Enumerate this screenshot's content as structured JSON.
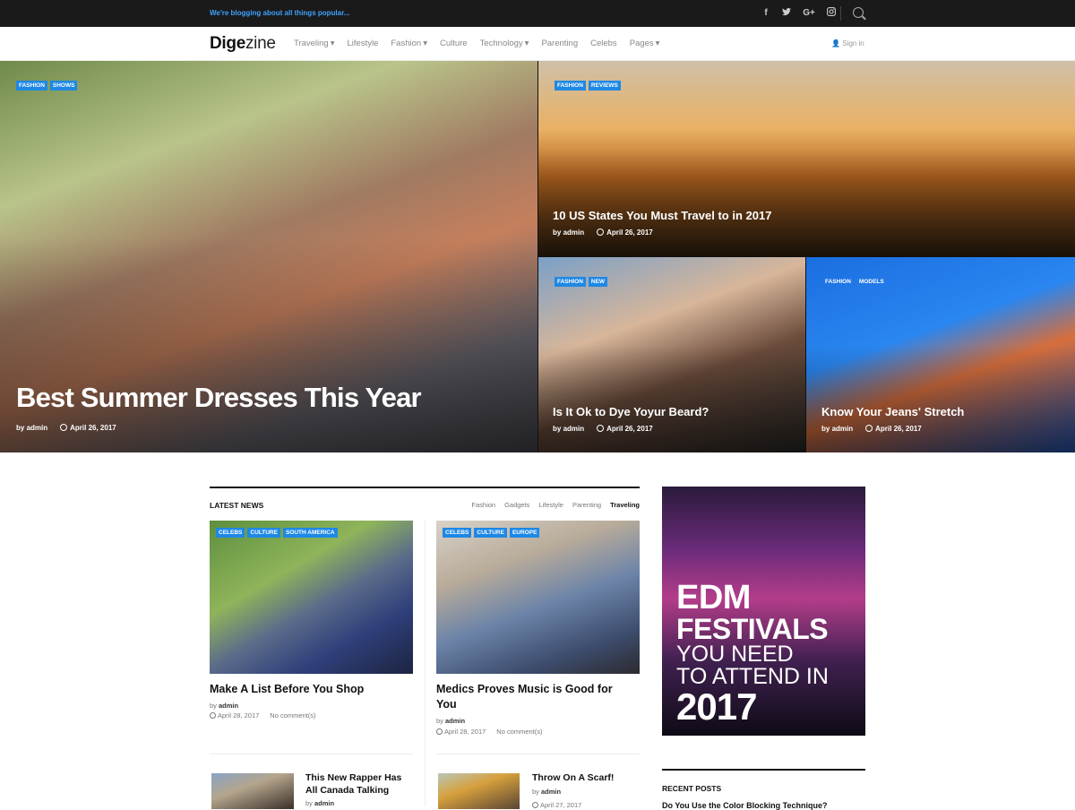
{
  "topbar": {
    "tagline": "We're blogging about all things popular...",
    "social_icons": [
      "facebook-icon",
      "twitter-icon",
      "google-plus-icon",
      "instagram-icon"
    ],
    "social_glyphs": [
      "f",
      "🐦",
      "G+",
      "◎"
    ]
  },
  "nav": {
    "logo_bold": "Dige",
    "logo_light": "zine",
    "items": [
      {
        "label": "Traveling",
        "has_dropdown": true
      },
      {
        "label": "Lifestyle",
        "has_dropdown": false
      },
      {
        "label": "Fashion",
        "has_dropdown": true
      },
      {
        "label": "Culture",
        "has_dropdown": false
      },
      {
        "label": "Technology",
        "has_dropdown": true
      },
      {
        "label": "Parenting",
        "has_dropdown": false
      },
      {
        "label": "Celebs",
        "has_dropdown": false
      },
      {
        "label": "Pages",
        "has_dropdown": true
      }
    ],
    "signin": "Sign in"
  },
  "hero": {
    "main": {
      "tags": [
        "FASHION",
        "SHOWS"
      ],
      "title": "Best Summer Dresses This Year",
      "author_prefix": "by",
      "author": "admin",
      "date": "April 26, 2017"
    },
    "top_right": {
      "tags": [
        "FASHION",
        "REVIEWS"
      ],
      "title": "10 US States You Must Travel to in 2017",
      "author_prefix": "by",
      "author": "admin",
      "date": "April 26, 2017"
    },
    "bottom_mid": {
      "tags": [
        "FASHION",
        "NEW"
      ],
      "title": "Is It Ok to Dye Yoyur Beard?",
      "author_prefix": "by",
      "author": "admin",
      "date": "April 26, 2017"
    },
    "bottom_right": {
      "tags": [
        "FASHION",
        "MODELS"
      ],
      "title": "Know Your Jeans' Stretch",
      "author_prefix": "by",
      "author": "admin",
      "date": "April 26, 2017"
    }
  },
  "latest": {
    "heading": "LATEST NEWS",
    "filters": [
      "Fashion",
      "Gadgets",
      "Lifestyle",
      "Parenting",
      "Traveling"
    ],
    "active_filter": "Traveling",
    "cards": [
      {
        "tags": [
          "CELEBS",
          "CULTURE",
          "SOUTH AMERICA"
        ],
        "title": "Make A List Before You Shop",
        "by": "by",
        "author": "admin",
        "date": "April 28, 2017",
        "comments": "No comment(s)"
      },
      {
        "tags": [
          "CELEBS",
          "CULTURE",
          "EUROPE"
        ],
        "title": "Medics Proves Music is Good for You",
        "by": "by",
        "author": "admin",
        "date": "April 28, 2017",
        "comments": "No comment(s)"
      }
    ],
    "small": [
      {
        "title": "This New Rapper Has All Canada Talking",
        "by": "by",
        "author": "admin"
      },
      {
        "title": "Throw On A Scarf!",
        "by": "by",
        "author": "admin",
        "date": "April 27, 2017"
      }
    ]
  },
  "ad": {
    "line1": "EDM",
    "line2": "FESTIVALS",
    "line3": "YOU NEED",
    "line4": "TO ATTEND IN",
    "line5": "2017"
  },
  "recent": {
    "heading": "RECENT POSTS",
    "first": "Do You Use the Color Blocking Technique?"
  }
}
